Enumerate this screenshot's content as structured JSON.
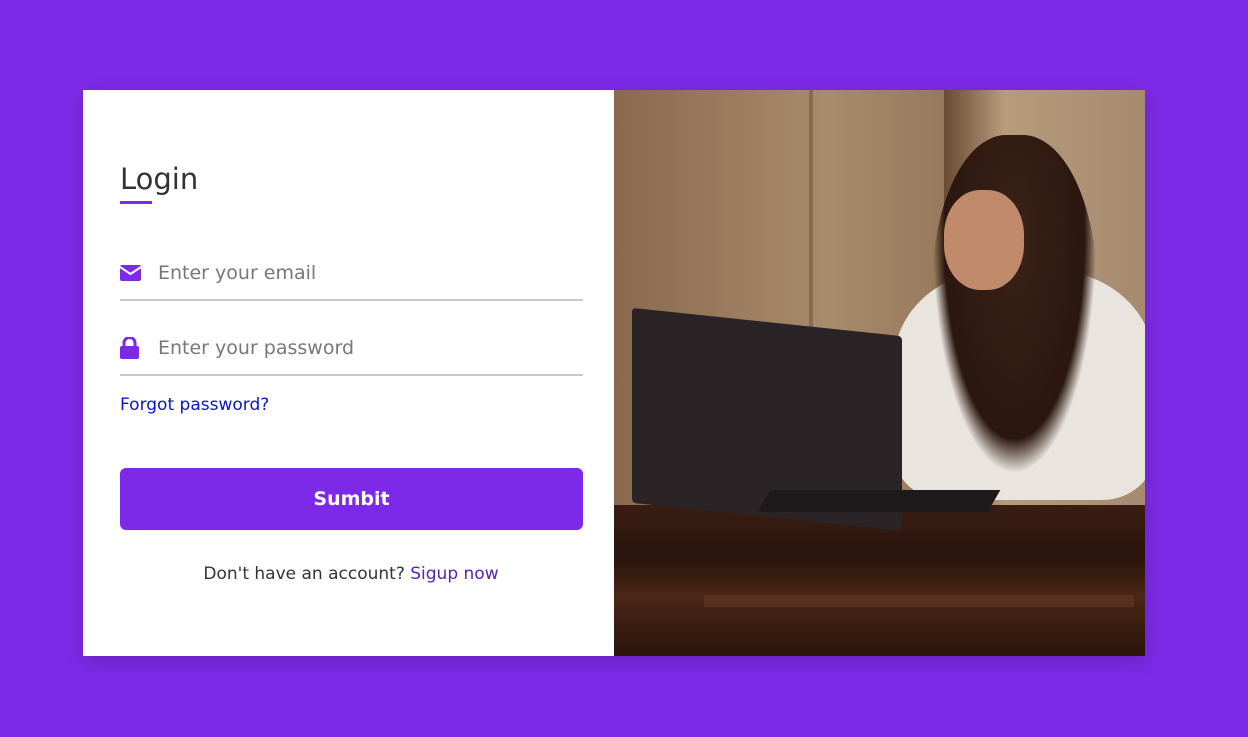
{
  "login": {
    "title": "Login",
    "email_placeholder": "Enter your email",
    "password_placeholder": "Enter your password",
    "forgot_label": "Forgot password?",
    "submit_label": "Sumbit",
    "signup_prompt": "Don't have an account?",
    "signup_link": "Sigup now"
  },
  "icons": {
    "email": "envelope-icon",
    "password": "lock-icon"
  },
  "colors": {
    "accent": "#7d2ae8",
    "link": "#0a14c9",
    "signup_link": "#5b21b6"
  }
}
